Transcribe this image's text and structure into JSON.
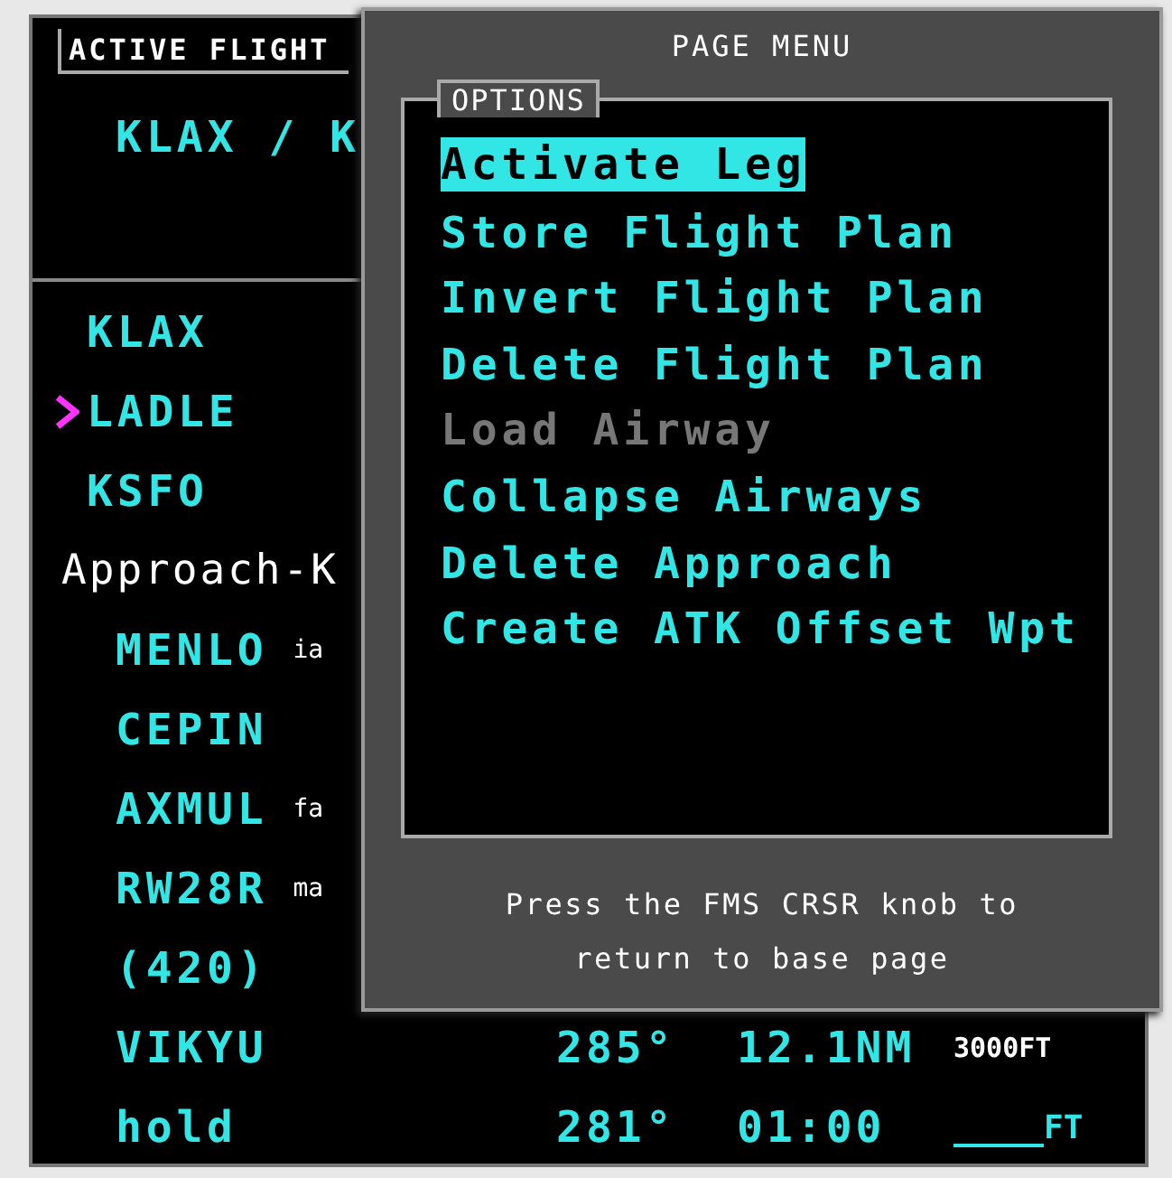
{
  "panel": {
    "title": "ACTIVE FLIGHT",
    "route": "KLAX / K"
  },
  "legs": [
    {
      "kind": "waypoint",
      "ident": "KLAX",
      "active": false
    },
    {
      "kind": "waypoint",
      "ident": "LADLE",
      "active": true
    },
    {
      "kind": "waypoint",
      "ident": "KSFO",
      "active": false
    },
    {
      "kind": "procedure",
      "ident": "Approach-K",
      "active": false,
      "children": [
        {
          "kind": "waypoint",
          "ident": "MENLO",
          "note": "ia",
          "active": false
        },
        {
          "kind": "waypoint",
          "ident": "CEPIN",
          "active": false
        },
        {
          "kind": "waypoint",
          "ident": "AXMUL",
          "note": "fa",
          "active": false
        },
        {
          "kind": "waypoint",
          "ident": "RW28R",
          "note": "ma",
          "active": false
        },
        {
          "kind": "waypoint",
          "ident": "(420)",
          "active": false
        },
        {
          "kind": "waypoint",
          "ident": "VIKYU",
          "active": false,
          "dtk": "285°",
          "dist": "12.1NM",
          "alt": {
            "kind": "value",
            "text": "3000FT"
          }
        },
        {
          "kind": "waypoint",
          "ident": "hold",
          "active": false,
          "dtk": "281°",
          "dist": "01:00",
          "alt": {
            "kind": "entry",
            "text": "FT"
          }
        }
      ]
    }
  ],
  "menu": {
    "title": "PAGE MENU",
    "group": "OPTIONS",
    "items": [
      {
        "label": "Activate Leg",
        "selected": true,
        "disabled": false
      },
      {
        "label": "Store Flight Plan",
        "selected": false,
        "disabled": false
      },
      {
        "label": "Invert Flight Plan",
        "selected": false,
        "disabled": false
      },
      {
        "label": "Delete Flight Plan",
        "selected": false,
        "disabled": false
      },
      {
        "label": "Load Airway",
        "selected": false,
        "disabled": true
      },
      {
        "label": "Collapse Airways",
        "selected": false,
        "disabled": false
      },
      {
        "label": "Delete Approach",
        "selected": false,
        "disabled": false
      },
      {
        "label": "Create ATK Offset Wpt",
        "selected": false,
        "disabled": false
      }
    ],
    "hint": "Press the FMS CRSR knob to return to base page"
  }
}
